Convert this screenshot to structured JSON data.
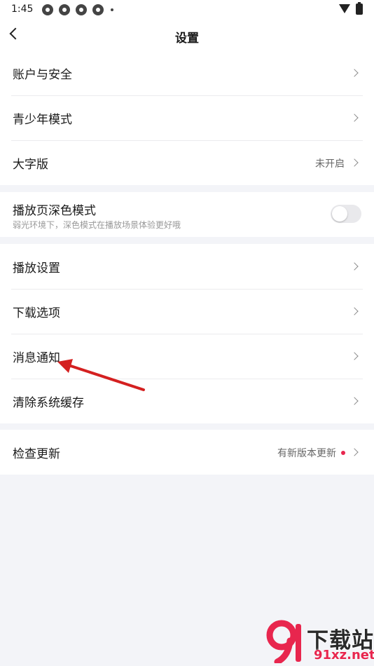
{
  "status_bar": {
    "time": "1:45"
  },
  "header": {
    "title": "设置"
  },
  "group1": [
    {
      "label": "账户与安全",
      "value": ""
    },
    {
      "label": "青少年模式",
      "value": ""
    },
    {
      "label": "大字版",
      "value": "未开启"
    }
  ],
  "dark_mode": {
    "title": "播放页深色模式",
    "subtitle": "弱光环境下，深色模式在播放场景体验更好哦",
    "enabled": false
  },
  "group3": [
    {
      "label": "播放设置"
    },
    {
      "label": "下载选项"
    },
    {
      "label": "消息通知"
    },
    {
      "label": "清除系统缓存"
    }
  ],
  "update": {
    "label": "检查更新",
    "value": "有新版本更新",
    "badge_color": "#e8264e"
  },
  "watermark": {
    "title": "下载站",
    "url": "91xz.net"
  },
  "colors": {
    "background": "#f3f4f8",
    "card": "#ffffff",
    "annotation_arrow": "#d42020"
  }
}
